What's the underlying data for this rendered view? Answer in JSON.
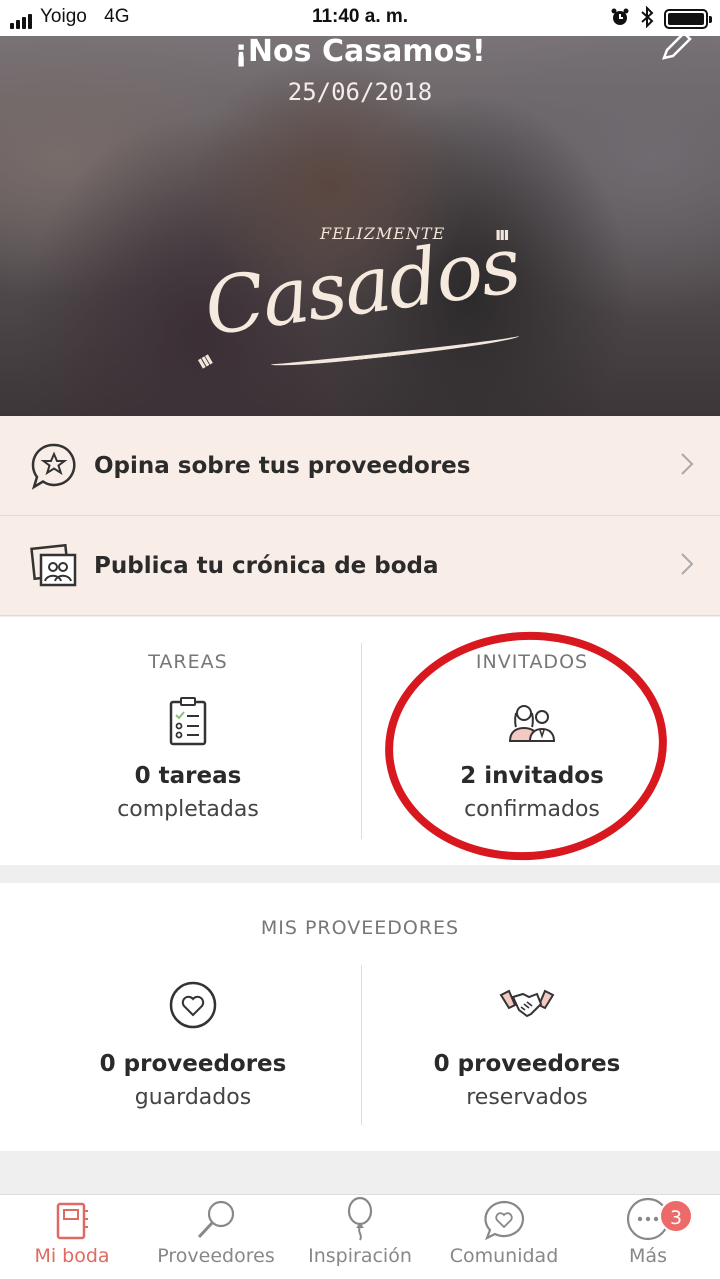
{
  "status_bar": {
    "carrier": "Yoigo",
    "network": "4G",
    "time": "11:40 a. m."
  },
  "hero": {
    "title": "¡Nos Casamos!",
    "date": "25/06/2018",
    "logo_small": "FELIZMENTE",
    "logo_main": "Casados"
  },
  "promos": [
    {
      "label": "Opina sobre tus proveedores",
      "icon": "star-chat-icon"
    },
    {
      "label": "Publica tu crónica de boda",
      "icon": "photo-album-icon"
    }
  ],
  "stats": {
    "tasks": {
      "heading": "TAREAS",
      "value": "0 tareas",
      "sub": "completadas",
      "icon": "checklist-icon"
    },
    "guests": {
      "heading": "INVITADOS",
      "value": "2 invitados",
      "sub": "confirmados",
      "icon": "guests-icon"
    }
  },
  "providers": {
    "title": "MIS PROVEEDORES",
    "saved": {
      "value": "0 proveedores",
      "sub": "guardados",
      "icon": "heart-icon"
    },
    "booked": {
      "value": "0 proveedores",
      "sub": "reservados",
      "icon": "handshake-icon"
    }
  },
  "bottom_nav": [
    {
      "label": "Mi boda",
      "icon": "planner-icon",
      "active": true
    },
    {
      "label": "Proveedores",
      "icon": "search-icon"
    },
    {
      "label": "Inspiración",
      "icon": "balloon-icon"
    },
    {
      "label": "Comunidad",
      "icon": "heart-chat-icon"
    },
    {
      "label": "Más",
      "icon": "more-icon",
      "badge": "3"
    }
  ],
  "colors": {
    "accent": "#e06a62",
    "promo_bg": "#f8ede7",
    "annotation_circle": "#d9171e",
    "badge": "#ec6a68"
  }
}
